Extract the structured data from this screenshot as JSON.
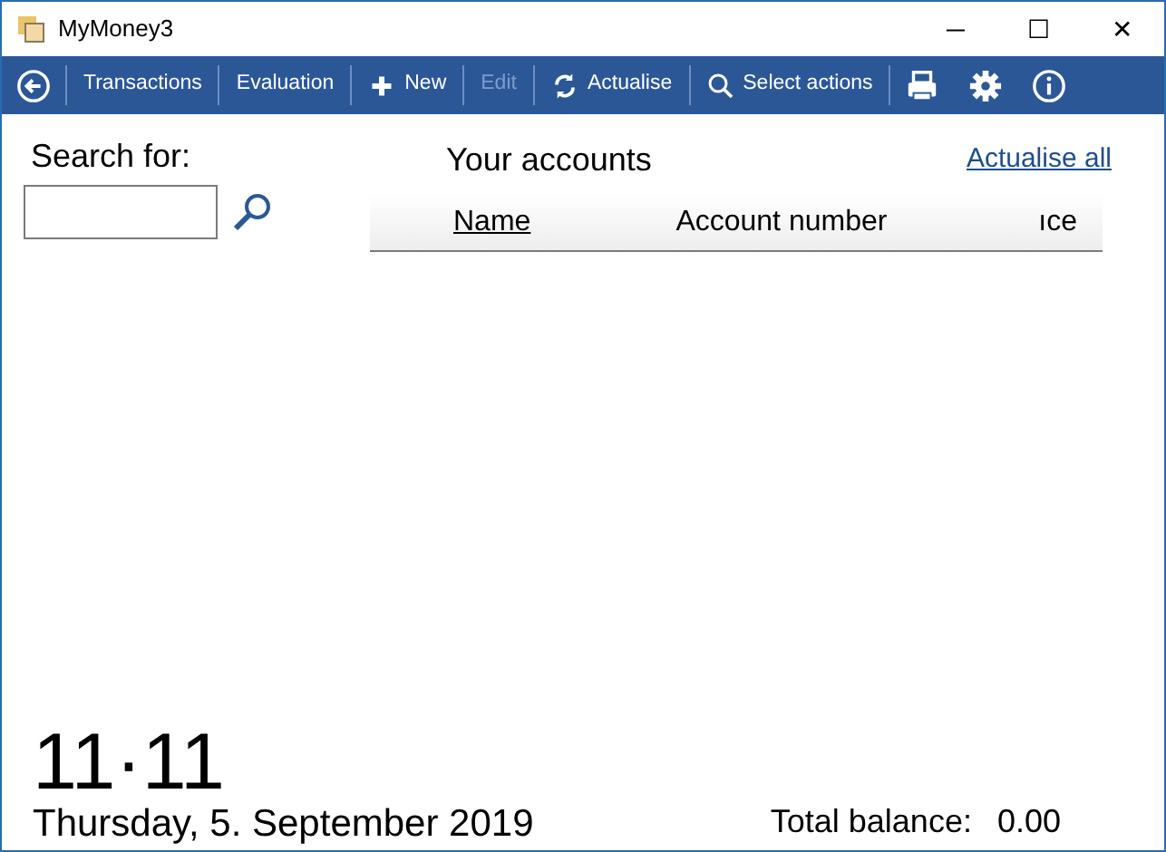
{
  "window": {
    "title": "MyMoney3",
    "controls": [
      "─",
      "☐",
      "✕"
    ]
  },
  "toolbar": {
    "items": [
      {
        "kind": "back"
      },
      {
        "kind": "text",
        "label": "Transactions",
        "disabled": false
      },
      {
        "kind": "text",
        "label": "Evaluation",
        "disabled": false
      },
      {
        "kind": "new",
        "label": "New",
        "disabled": false
      },
      {
        "kind": "text",
        "label": "Edit",
        "disabled": true
      },
      {
        "kind": "refresh",
        "label": "Actualise",
        "disabled": false
      },
      {
        "kind": "search",
        "label": "Select actions",
        "disabled": false
      },
      {
        "kind": "print"
      },
      {
        "kind": "settings"
      },
      {
        "kind": "info"
      }
    ]
  },
  "search": {
    "label": "Search for:"
  },
  "accounts": {
    "title": "Your accounts",
    "link": "Actualise all",
    "columns": [
      {
        "label": "Name",
        "sorted": true
      },
      {
        "label": "Account number",
        "sorted": false
      },
      {
        "label": "ıce",
        "sorted": false
      }
    ]
  },
  "footer": {
    "time": "11·11",
    "date": "Thursday, 5. September 2019",
    "total_label": "Total balance:",
    "total_value": "0.00"
  }
}
